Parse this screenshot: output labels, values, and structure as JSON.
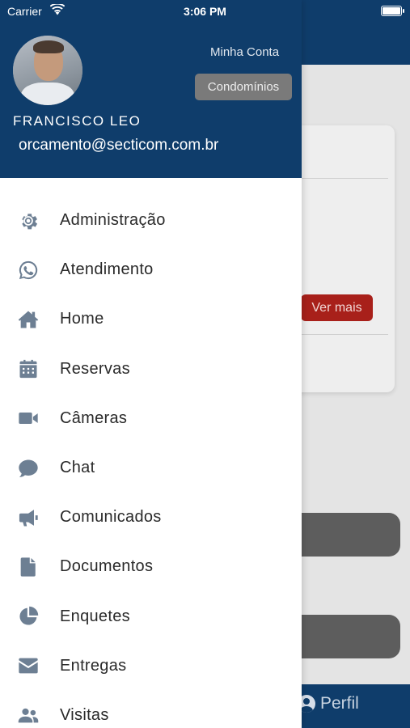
{
  "status_bar": {
    "carrier": "Carrier",
    "time": "3:06 PM"
  },
  "background": {
    "ver_mais": "Ver mais",
    "tab_perfil": "Perfil"
  },
  "drawer": {
    "minha_conta": "Minha Conta",
    "condominios": "Condomínios",
    "user_name": "FRANCISCO LEO",
    "user_email": "orcamento@secticom.com.br",
    "items": [
      {
        "label": "Administração",
        "icon": "gear-icon"
      },
      {
        "label": "Atendimento",
        "icon": "whatsapp-icon"
      },
      {
        "label": "Home",
        "icon": "home-icon"
      },
      {
        "label": "Reservas",
        "icon": "calendar-icon"
      },
      {
        "label": "Câmeras",
        "icon": "video-camera-icon"
      },
      {
        "label": "Chat",
        "icon": "chat-bubble-icon"
      },
      {
        "label": "Comunicados",
        "icon": "megaphone-icon"
      },
      {
        "label": "Documentos",
        "icon": "document-icon"
      },
      {
        "label": "Enquetes",
        "icon": "pie-chart-icon"
      },
      {
        "label": "Entregas",
        "icon": "envelope-icon"
      },
      {
        "label": "Visitas",
        "icon": "people-icon"
      }
    ]
  },
  "colors": {
    "primary": "#0f3d6b",
    "icon": "#6d7f93",
    "accent_red": "#a8201a",
    "button_gray": "#7a7a7a"
  }
}
